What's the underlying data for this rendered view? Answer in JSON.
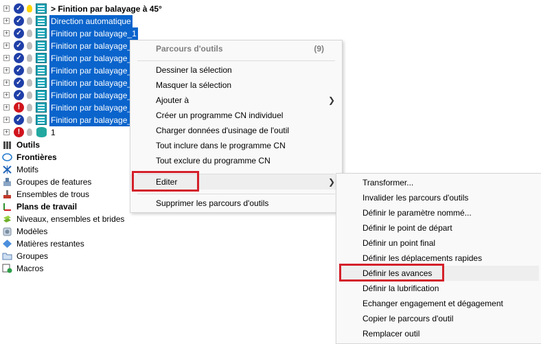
{
  "tree": {
    "toolpaths": [
      {
        "label": "> Finition par balayage à 45°",
        "status": "ok",
        "bulb": "on",
        "selected": false,
        "bold": true,
        "icon": "toolpath-icon"
      },
      {
        "label": "Direction automatique",
        "status": "ok",
        "bulb": "off",
        "selected": true,
        "bold": false,
        "icon": "toolpath-icon"
      },
      {
        "label": "Finition par balayage_1",
        "status": "ok",
        "bulb": "off",
        "selected": true,
        "bold": false,
        "icon": "toolpath-icon"
      },
      {
        "label": "Finition par balayage_",
        "status": "ok",
        "bulb": "off",
        "selected": true,
        "bold": false,
        "icon": "toolpath-icon"
      },
      {
        "label": "Finition par balayage_",
        "status": "ok",
        "bulb": "off",
        "selected": true,
        "bold": false,
        "icon": "toolpath-icon"
      },
      {
        "label": "Finition par balayage_",
        "status": "ok",
        "bulb": "off",
        "selected": true,
        "bold": false,
        "icon": "toolpath-icon"
      },
      {
        "label": "Finition par balayage_",
        "status": "ok",
        "bulb": "off",
        "selected": true,
        "bold": false,
        "icon": "toolpath-icon"
      },
      {
        "label": "Finition par balayage_",
        "status": "ok",
        "bulb": "off",
        "selected": true,
        "bold": false,
        "icon": "toolpath-icon"
      },
      {
        "label": "Finition par balayage_",
        "status": "error",
        "bulb": "off",
        "selected": true,
        "bold": false,
        "icon": "toolpath-icon"
      },
      {
        "label": "Finition par balayage_",
        "status": "ok",
        "bulb": "off",
        "selected": true,
        "bold": false,
        "icon": "toolpath-icon"
      },
      {
        "label": "1",
        "status": "error",
        "bulb": "off",
        "selected": false,
        "bold": false,
        "icon": "stack-icon"
      }
    ],
    "folders": [
      {
        "label": "Outils",
        "bold": true,
        "icon": "tools-icon",
        "color": "#4a4a4a"
      },
      {
        "label": "Frontières",
        "bold": true,
        "icon": "boundary-icon",
        "color": "#2a7fd0"
      },
      {
        "label": "Motifs",
        "bold": false,
        "icon": "pattern-icon",
        "color": "#1e63b8"
      },
      {
        "label": "Groupes de features",
        "bold": false,
        "icon": "feature-groups-icon",
        "color": "#8aa6c4"
      },
      {
        "label": "Ensembles de trous",
        "bold": false,
        "icon": "hole-sets-icon",
        "color": "#c0392b"
      },
      {
        "label": "Plans de travail",
        "bold": true,
        "icon": "workplane-icon",
        "color": "#d02020"
      },
      {
        "label": "Niveaux, ensembles et brides",
        "bold": false,
        "icon": "levels-icon",
        "color": "#9dd34a"
      },
      {
        "label": "Modèles",
        "bold": false,
        "icon": "models-icon",
        "color": "#7a8ea3"
      },
      {
        "label": "Matières restantes",
        "bold": false,
        "icon": "stock-icon",
        "color": "#4b8fdc"
      },
      {
        "label": "Groupes",
        "bold": false,
        "icon": "groups-folder-icon",
        "color": "#5a7fb0"
      },
      {
        "label": "Macros",
        "bold": false,
        "icon": "macros-icon",
        "color": "#2e9e48"
      }
    ]
  },
  "context_menu": {
    "header": "Parcours d'outils",
    "count": "(9)",
    "items": [
      {
        "label": "Dessiner la sélection",
        "submenu": false
      },
      {
        "label": "Masquer la sélection",
        "submenu": false
      },
      {
        "label": "Ajouter à",
        "submenu": true
      },
      {
        "label": "Créer un programme CN individuel",
        "submenu": false
      },
      {
        "label": "Charger données d'usinage de l'outil",
        "submenu": false
      },
      {
        "label": "Tout inclure dans le programme CN",
        "submenu": false
      },
      {
        "label": "Tout exclure du programme CN",
        "submenu": false
      }
    ],
    "edit_item": "Editer",
    "delete_item": "Supprimer les parcours d'outils"
  },
  "submenu": {
    "items": [
      "Transformer...",
      "Invalider les parcours d'outils",
      "Définir le paramètre nommé...",
      "Définir le point de départ",
      "Définir un point final",
      "Définir les déplacements rapides",
      "Définir les avances",
      "Définir la lubrification",
      "Echanger engagement et dégagement",
      "Copier le parcours d'outil",
      "Remplacer outil"
    ],
    "highlighted_index": 6
  },
  "colors": {
    "selection": "#0a64cc",
    "highlight_box": "#d4202a",
    "ok_status": "#1f3fa8",
    "error_status": "#d0141d"
  }
}
